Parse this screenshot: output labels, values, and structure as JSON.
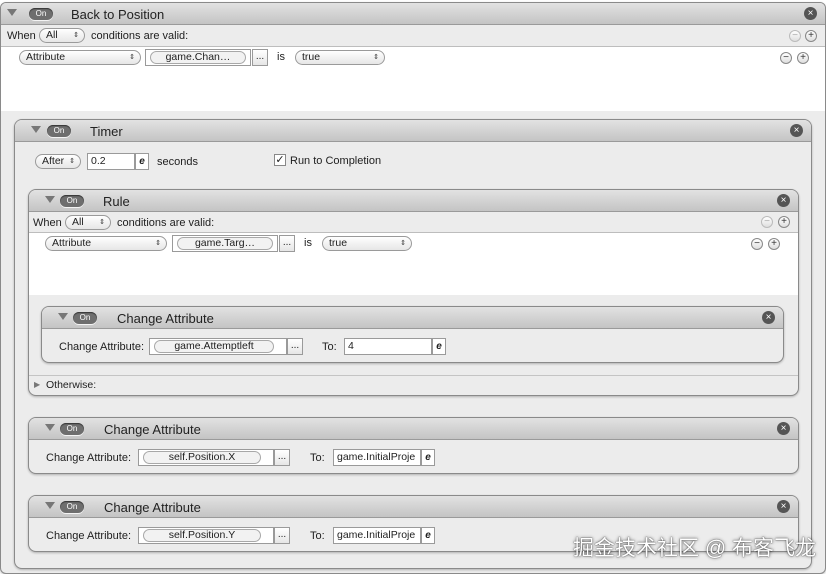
{
  "back_to_position": {
    "on_label": "On",
    "title": "Back to Position",
    "when_label": "When",
    "when_select": "All",
    "conditions_label": "conditions are valid:",
    "condition": {
      "type": "Attribute",
      "attribute": "game.Chan…",
      "op": "is",
      "value": "true"
    }
  },
  "timer": {
    "on_label": "On",
    "title": "Timer",
    "mode": "After",
    "value": "0.2",
    "unit_label": "seconds",
    "run_to_completion_label": "Run to Completion",
    "run_to_completion_checked": true
  },
  "rule": {
    "on_label": "On",
    "title": "Rule",
    "when_label": "When",
    "when_select": "All",
    "conditions_label": "conditions are valid:",
    "condition": {
      "type": "Attribute",
      "attribute": "game.Targ…",
      "op": "is",
      "value": "true"
    },
    "otherwise_label": "Otherwise:"
  },
  "change_attr_1": {
    "on_label": "On",
    "title": "Change Attribute",
    "label": "Change Attribute:",
    "attribute": "game.Attemptleft",
    "to_label": "To:",
    "value": "4"
  },
  "change_attr_2": {
    "on_label": "On",
    "title": "Change Attribute",
    "label": "Change Attribute:",
    "attribute": "self.Position.X",
    "to_label": "To:",
    "value": "game.InitialProje"
  },
  "change_attr_3": {
    "on_label": "On",
    "title": "Change Attribute",
    "label": "Change Attribute:",
    "attribute": "self.Position.Y",
    "to_label": "To:",
    "value": "game.InitialProje"
  },
  "glyphs": {
    "close": "×",
    "plus": "+",
    "minus": "−",
    "dots": "...",
    "expr": "e",
    "arrows": "⇕",
    "check": "✓",
    "expand": "▶"
  },
  "watermark": "掘金技术社区 @ 布客飞龙"
}
